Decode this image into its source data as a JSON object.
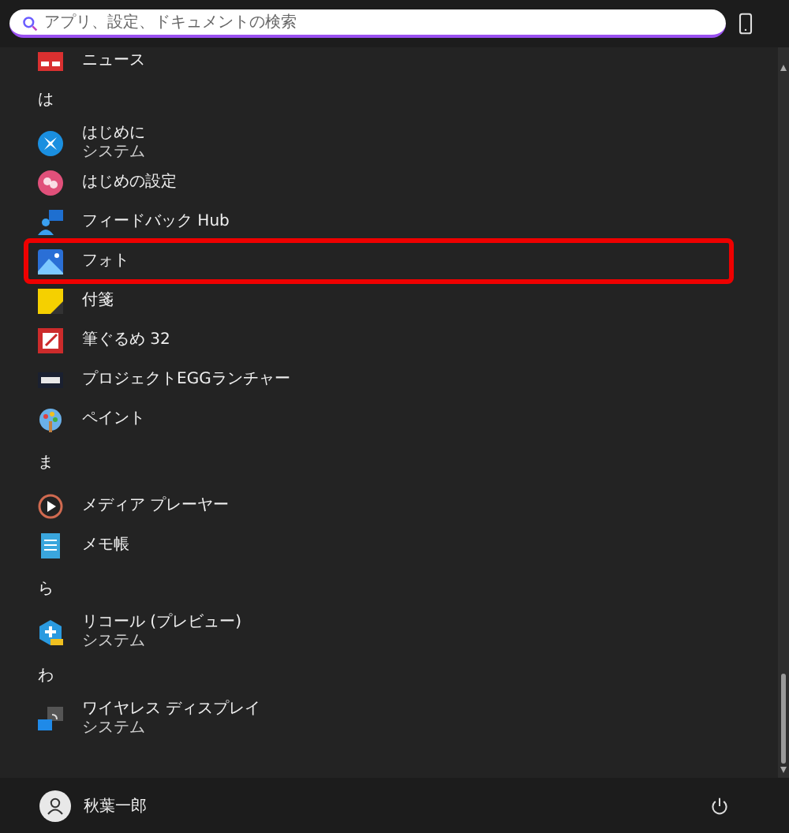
{
  "search": {
    "placeholder": "アプリ、設定、ドキュメントの検索"
  },
  "sections": [
    {
      "apps": [
        {
          "name": "ニュース",
          "kind": "news",
          "highlighted": false
        }
      ]
    },
    {
      "letter": "は",
      "apps": [
        {
          "name": "はじめに",
          "subtitle": "システム",
          "kind": "start",
          "highlighted": false
        },
        {
          "name": "はじめの設定",
          "kind": "setup",
          "highlighted": false
        },
        {
          "name": "フィードバック Hub",
          "kind": "feedback",
          "highlighted": false
        },
        {
          "name": "フォト",
          "kind": "photo",
          "highlighted": true
        },
        {
          "name": "付箋",
          "kind": "sticky",
          "highlighted": false
        },
        {
          "name": "筆ぐるめ 32",
          "kind": "fude",
          "highlighted": false
        },
        {
          "name": "プロジェクトEGGランチャー",
          "kind": "egg",
          "highlighted": false
        },
        {
          "name": "ペイント",
          "kind": "paint",
          "highlighted": false
        }
      ]
    },
    {
      "letter": "ま",
      "apps": [
        {
          "name": "メディア プレーヤー",
          "kind": "media",
          "highlighted": false
        },
        {
          "name": "メモ帳",
          "kind": "notepad",
          "highlighted": false
        }
      ]
    },
    {
      "letter": "ら",
      "apps": [
        {
          "name": "リコール (プレビュー)",
          "subtitle": "システム",
          "kind": "recall",
          "highlighted": false
        }
      ]
    },
    {
      "letter": "わ",
      "apps": [
        {
          "name": "ワイヤレス ディスプレイ",
          "subtitle": "システム",
          "kind": "wireless",
          "highlighted": false
        }
      ]
    }
  ],
  "user": {
    "name": "秋葉一郎"
  }
}
